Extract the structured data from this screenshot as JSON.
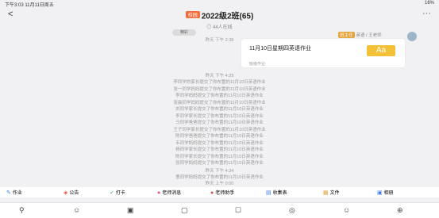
{
  "status": {
    "time_date": "下午3:03  11月11日周五",
    "battery": "16%"
  },
  "header": {
    "back": "<",
    "tag": "校园",
    "title": "2022级2班(65)",
    "online": "◎ 44人在线",
    "more": "···"
  },
  "chip": "精彩",
  "time_top": "昨天 下午 2:38",
  "card": {
    "sender_tag": "班主任",
    "sender_name": "英语 / 王老师",
    "title": "11月10日星期四英语作业",
    "icon_text": "Aa",
    "subtitle": "班级作业"
  },
  "time_mid": "昨天 下午 4:29",
  "system_messages": [
    "李同学的家长提交了你布置的11月10日英语作业",
    "张一同学妈妈提交了你布置的11月10日英语作业",
    "李同学妈妈提交了你布置的11月10日英语作业",
    "张晨同学妈妈提交了你布置的11月10日英语作业",
    "刘同学家长提交了你布置的11月10日英语作业",
    "李同学家长提交了你布置的11月10日英语作业",
    "马同学爸爸提交了你布置的11月10日英语作业",
    "王子同学家长提交了你布置的11月10日英语作业",
    "陈同学爸爸提交了你布置的11月10日英语作业",
    "韦同学妈妈提交了你布置的11月10日英语作业",
    "杨同学家长提交了你布置的11月10日英语作业",
    "陈同学家长提交了你布置的11月10日英语作业",
    "张同学妈妈提交了你布置的11月10日英语作业"
  ],
  "time_bottom": "昨天 下午 4:34",
  "last_message": "曹同学妈妈提交了你布置的11月10日英语作业",
  "time_last": "昨天 上午 0:00",
  "toolbar": [
    {
      "icon": "✎",
      "label": "作业",
      "color": "#3b7be0"
    },
    {
      "icon": "◈",
      "label": "公告",
      "color": "#e34d3b"
    },
    {
      "icon": "✓",
      "label": "打卡",
      "color": "#36a66b"
    },
    {
      "icon": "●",
      "label": "老师消息",
      "color": "#e05577"
    },
    {
      "icon": "●",
      "label": "老师助手",
      "color": "#d94e4e"
    },
    {
      "icon": "▤",
      "label": "收集表",
      "color": "#3b7be0"
    },
    {
      "icon": "▦",
      "label": "文件",
      "color": "#e6a23c"
    },
    {
      "icon": "▣",
      "label": "相册",
      "color": "#3b7be0"
    }
  ],
  "nav": [
    "⚲",
    "☺",
    "▣",
    "▢",
    "☐",
    "◎",
    "☺",
    "⊕"
  ]
}
